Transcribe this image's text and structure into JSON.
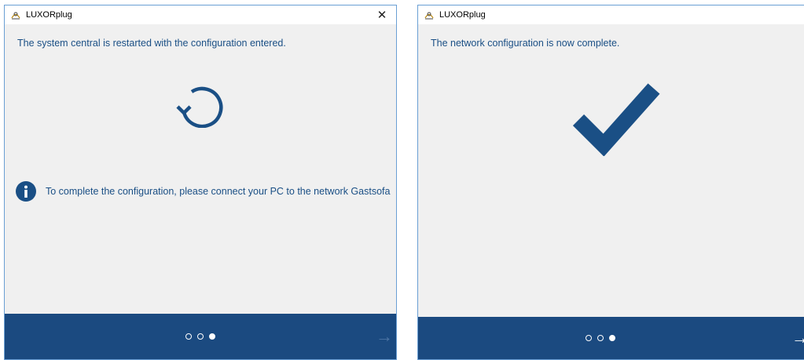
{
  "colors": {
    "accent": "#1a4f85",
    "footer": "#1b4a80",
    "panel": "#f0f0f0"
  },
  "left_window": {
    "title": "LUXORplug",
    "app_icon": "luxorplug-app-icon",
    "close_icon": "close-icon",
    "close_glyph": "✕",
    "message": "The system central is restarted with the configuration entered.",
    "status_icon": "restart-icon",
    "info_icon": "info-icon",
    "info_text": "To complete the configuration, please connect your PC to the network Gastsofa",
    "pagination": {
      "total": 3,
      "current": 3
    },
    "next_arrow": "→",
    "next_enabled": false
  },
  "right_window": {
    "title": "LUXORplug",
    "app_icon": "luxorplug-app-icon",
    "close_icon": "close-icon",
    "close_glyph": "✕",
    "message": "The network configuration is now complete.",
    "status_icon": "checkmark-icon",
    "pagination": {
      "total": 3,
      "current": 3
    },
    "next_arrow": "→",
    "next_enabled": true
  }
}
